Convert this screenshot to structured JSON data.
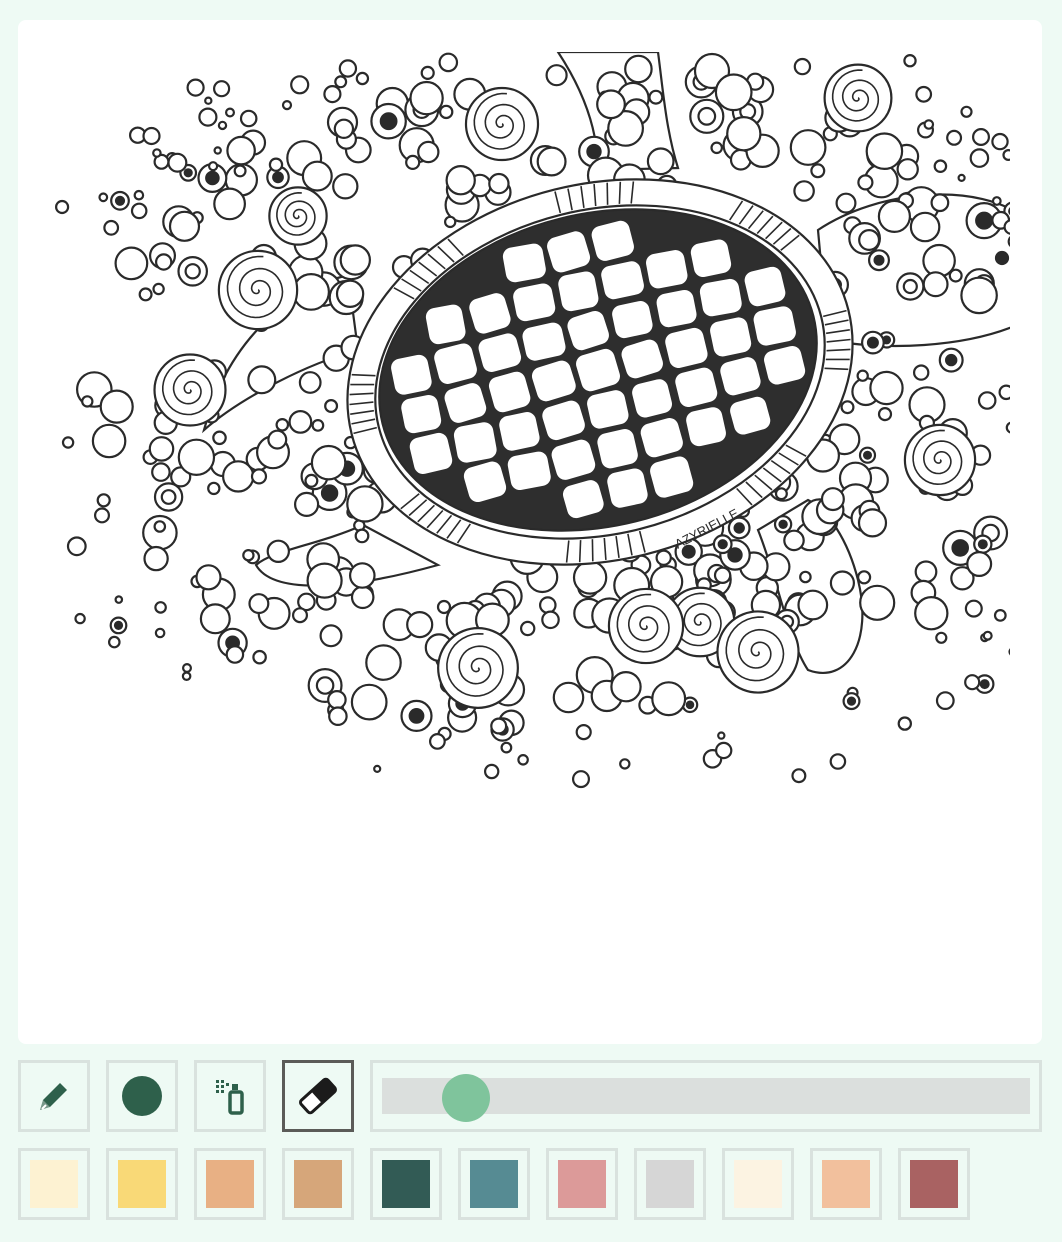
{
  "canvas": {
    "signature": "AZYRIELLE",
    "line_color": "#2a2a2a",
    "background": "#ffffff"
  },
  "tools": [
    {
      "name": "pencil-icon",
      "active": false
    },
    {
      "name": "brush-icon",
      "active": false,
      "color": "#2e604b"
    },
    {
      "name": "spray-icon",
      "active": false
    },
    {
      "name": "eraser-icon",
      "active": true
    }
  ],
  "brush_size": {
    "percent": 13
  },
  "accent_color": "#7fc49c",
  "palette": [
    {
      "name": "cream",
      "color": "#fdf2d2"
    },
    {
      "name": "yellow",
      "color": "#f9d977"
    },
    {
      "name": "apricot",
      "color": "#e8b084"
    },
    {
      "name": "tan",
      "color": "#d6a67a"
    },
    {
      "name": "dark-teal",
      "color": "#325b55"
    },
    {
      "name": "teal",
      "color": "#568b93"
    },
    {
      "name": "rose",
      "color": "#dc9a99"
    },
    {
      "name": "light-gray",
      "color": "#d6d6d6"
    },
    {
      "name": "ivory",
      "color": "#fcf3e2"
    },
    {
      "name": "peach",
      "color": "#f2c09d"
    },
    {
      "name": "maroon",
      "color": "#a96262"
    }
  ]
}
